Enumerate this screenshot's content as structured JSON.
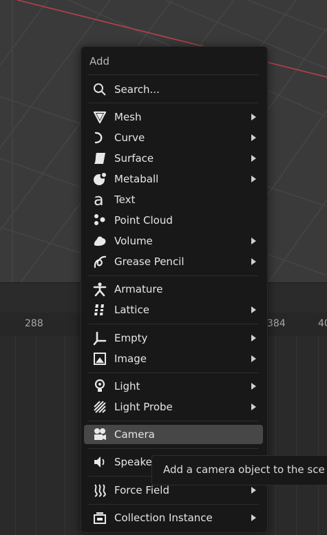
{
  "timeline": {
    "frames": [
      "288",
      "384",
      "40"
    ]
  },
  "menu": {
    "title": "Add",
    "search_label": "Search...",
    "items": [
      {
        "label": "Mesh",
        "icon": "mesh-icon",
        "submenu": true
      },
      {
        "label": "Curve",
        "icon": "curve-icon",
        "submenu": true
      },
      {
        "label": "Surface",
        "icon": "surface-icon",
        "submenu": true
      },
      {
        "label": "Metaball",
        "icon": "metaball-icon",
        "submenu": true
      },
      {
        "label": "Text",
        "icon": "text-icon",
        "submenu": false
      },
      {
        "label": "Point Cloud",
        "icon": "point-cloud-icon",
        "submenu": false
      },
      {
        "label": "Volume",
        "icon": "volume-icon",
        "submenu": true
      },
      {
        "label": "Grease Pencil",
        "icon": "grease-pencil-icon",
        "submenu": true
      },
      {
        "label": "Armature",
        "icon": "armature-icon",
        "submenu": false
      },
      {
        "label": "Lattice",
        "icon": "lattice-icon",
        "submenu": true
      },
      {
        "label": "Empty",
        "icon": "empty-icon",
        "submenu": true
      },
      {
        "label": "Image",
        "icon": "image-icon",
        "submenu": true
      },
      {
        "label": "Light",
        "icon": "light-icon",
        "submenu": true
      },
      {
        "label": "Light Probe",
        "icon": "light-probe-icon",
        "submenu": true
      },
      {
        "label": "Camera",
        "icon": "camera-icon",
        "submenu": false,
        "active": true
      },
      {
        "label": "Speake",
        "icon": "speaker-icon",
        "submenu": false
      },
      {
        "label": "Force Field",
        "icon": "force-field-icon",
        "submenu": true
      },
      {
        "label": "Collection Instance",
        "icon": "collection-instance-icon",
        "submenu": true
      }
    ]
  },
  "tooltip": {
    "text": "Add a camera object to the sce"
  },
  "colors": {
    "menu_bg": "#181818",
    "highlight": "#474747",
    "axis_red": "#b5414b"
  }
}
